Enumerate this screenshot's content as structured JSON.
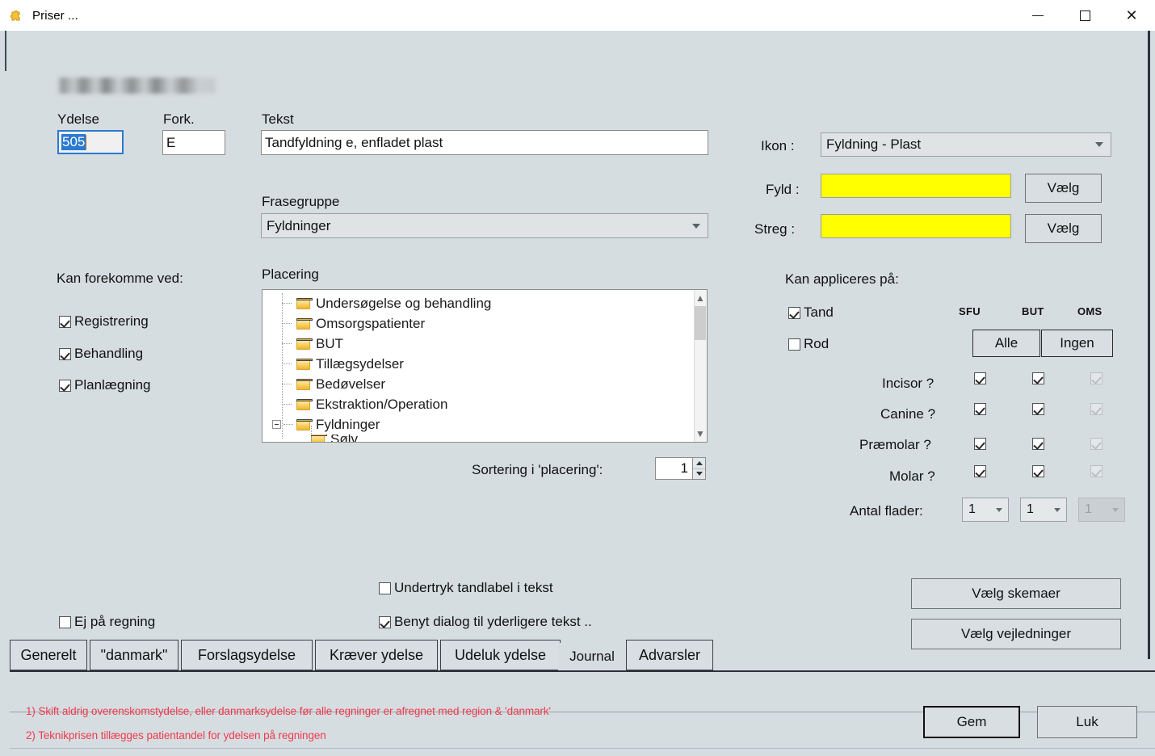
{
  "window": {
    "title": "Priser ...",
    "icon": "puzzle-piece-icon",
    "minimize_label": "—",
    "maximize_label": "☐",
    "close_label": "✕"
  },
  "form": {
    "patient_name_redacted": "",
    "ydelse": {
      "label": "Ydelse",
      "value": "505"
    },
    "fork": {
      "label": "Fork.",
      "value": "E"
    },
    "tekst": {
      "label": "Tekst",
      "value": "Tandfyldning e, enfladet plast"
    },
    "frasegruppe": {
      "label": "Frasegruppe",
      "value": "Fyldninger"
    }
  },
  "appearance": {
    "ikon": {
      "label": "Ikon :",
      "value": "Fyldning - Plast"
    },
    "fyld": {
      "label": "Fyld :",
      "color": "#ffff00",
      "button": "Vælg"
    },
    "streg": {
      "label": "Streg :",
      "color": "#ffff00",
      "button": "Vælg"
    }
  },
  "kan_forekomme_ved": {
    "title": "Kan forekomme ved:",
    "items": [
      {
        "label": "Registrering",
        "checked": true
      },
      {
        "label": "Behandling",
        "checked": true
      },
      {
        "label": "Planlægning",
        "checked": true
      }
    ]
  },
  "placering": {
    "label": "Placering",
    "nodes": [
      {
        "label": "Undersøgelse og behandling",
        "level": 1,
        "expandable": false
      },
      {
        "label": "Omsorgspatienter",
        "level": 1,
        "expandable": false
      },
      {
        "label": "BUT",
        "level": 1,
        "expandable": false
      },
      {
        "label": "Tillægsydelser",
        "level": 1,
        "expandable": false
      },
      {
        "label": "Bedøvelser",
        "level": 1,
        "expandable": false
      },
      {
        "label": "Ekstraktion/Operation",
        "level": 1,
        "expandable": false
      },
      {
        "label": "Fyldninger",
        "level": 1,
        "expandable": true
      },
      {
        "label": "Sølv",
        "level": 2,
        "expandable": false
      }
    ]
  },
  "sortering": {
    "label": "Sortering i 'placering':",
    "value": "1"
  },
  "kan_appliceres_pa": {
    "title": "Kan appliceres på:",
    "tand": {
      "label": "Tand",
      "checked": true
    },
    "rod": {
      "label": "Rod",
      "checked": false
    },
    "columns": [
      "SFU",
      "BUT",
      "OMS"
    ],
    "alle_button": "Alle",
    "ingen_button": "Ingen",
    "rows": [
      {
        "label": "Incisor ?",
        "sfu": true,
        "but": true,
        "oms": true
      },
      {
        "label": "Canine ?",
        "sfu": true,
        "but": true,
        "oms": true
      },
      {
        "label": "Præmolar ?",
        "sfu": true,
        "but": true,
        "oms": true
      },
      {
        "label": "Molar ?",
        "sfu": true,
        "but": true,
        "oms": true
      }
    ],
    "oms_disabled": true,
    "antal_flader": {
      "label": "Antal flader:",
      "sfu": "1",
      "but": "1",
      "oms": "1",
      "oms_disabled": true
    }
  },
  "options": {
    "ej_pa_regning": {
      "label": "Ej på regning",
      "checked": false
    },
    "undertryk_tandlabel": {
      "label": "Undertryk tandlabel i tekst",
      "checked": false
    },
    "benyt_dialog": {
      "label": "Benyt dialog til yderligere tekst ..",
      "checked": true
    }
  },
  "side_buttons": {
    "vaelg_skemaer": "Vælg skemaer",
    "vaelg_vejledninger": "Vælg vejledninger"
  },
  "tabs": [
    {
      "label": "Generelt",
      "active": false
    },
    {
      "label": "\"danmark\"",
      "active": false
    },
    {
      "label": "Forslagsydelse",
      "active": false
    },
    {
      "label": "Kræver ydelse",
      "active": false
    },
    {
      "label": "Udeluk ydelse",
      "active": false
    },
    {
      "label": "Journal",
      "active": true
    },
    {
      "label": "Advarsler",
      "active": false
    }
  ],
  "warnings": [
    "1) Skift aldrig overenskomstydelse, eller danmarksydelse før alle regninger er afregnet med region & 'danmark'",
    "2) Teknikprisen tillægges patientandel for ydelsen på regningen"
  ],
  "footer_buttons": {
    "gem": "Gem",
    "luk": "Luk"
  },
  "colors": {
    "background": "#d6dde1",
    "swatch_yellow": "#ffff00",
    "warning_red": "#ef3a4e",
    "selection_blue": "#2b7ad1"
  }
}
